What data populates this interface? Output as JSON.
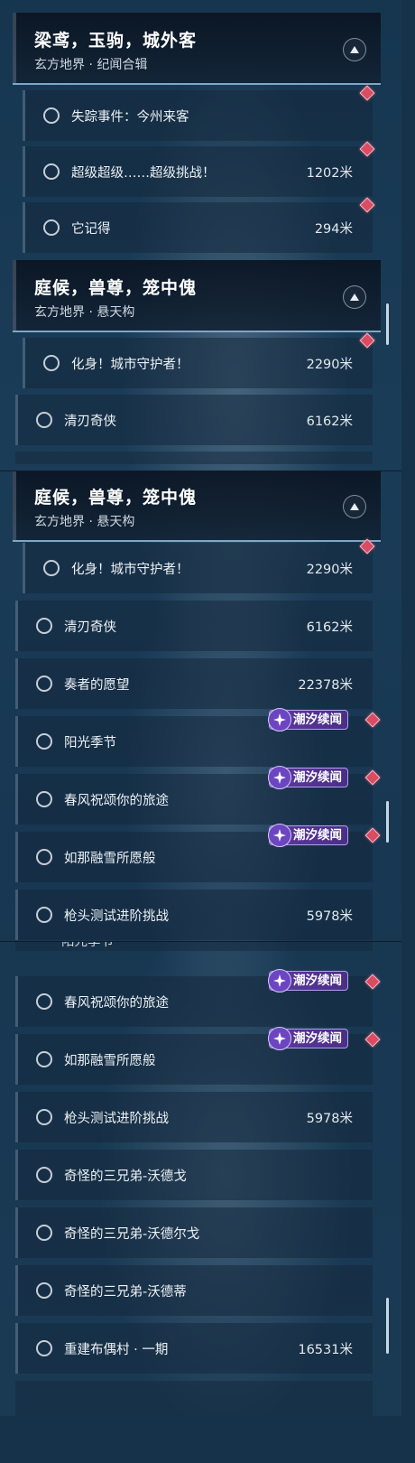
{
  "panel1": {
    "header": {
      "title": "梁鸢，玉驹，城外客",
      "subtitle": "玄方地界 · 纪闻合辑"
    },
    "items": [
      {
        "label": "失踪事件：今州来客",
        "distance": ""
      },
      {
        "label": "超级超级……超级挑战！",
        "distance": "1202米"
      },
      {
        "label": "它记得",
        "distance": "294米"
      }
    ],
    "header2": {
      "title": "庭候，兽尊，笼中傀",
      "subtitle": "玄方地界 · 悬天构"
    },
    "items2": [
      {
        "label": "化身！城市守护者！",
        "distance": "2290米"
      },
      {
        "label": "清刃奇侠",
        "distance": "6162米"
      }
    ]
  },
  "panel2": {
    "header": {
      "title": "庭候，兽尊，笼中傀",
      "subtitle": "玄方地界 · 悬天构"
    },
    "items": [
      {
        "label": "化身！城市守护者！",
        "distance": "2290米"
      },
      {
        "label": "清刃奇侠",
        "distance": "6162米"
      },
      {
        "label": "奏者的愿望",
        "distance": "22378米"
      },
      {
        "label": "阳光季节",
        "distance": ""
      },
      {
        "label": "春风祝颂你的旅途",
        "distance": ""
      },
      {
        "label": "如那融雪所愿般",
        "distance": ""
      },
      {
        "label": "枪头测试进阶挑战",
        "distance": "5978米"
      }
    ]
  },
  "panel3": {
    "partial_label": "阳光季节",
    "items": [
      {
        "label": "春风祝颂你的旅途",
        "distance": ""
      },
      {
        "label": "如那融雪所愿般",
        "distance": ""
      },
      {
        "label": "枪头测试进阶挑战",
        "distance": "5978米"
      },
      {
        "label": "奇怪的三兄弟-沃德戈",
        "distance": ""
      },
      {
        "label": "奇怪的三兄弟-沃德尔戈",
        "distance": ""
      },
      {
        "label": "奇怪的三兄弟-沃德蒂",
        "distance": ""
      },
      {
        "label": "重建布偶村 · 一期",
        "distance": "16531米"
      }
    ]
  },
  "tag_label": "潮汐续闻",
  "icons": {
    "collapse": "chevron-up-icon",
    "radio": "radio-empty-icon",
    "marker": "diamond-marker-icon",
    "tag": "tidal-star-icon"
  },
  "colors": {
    "marker": "#d94c62",
    "tag_bg": "#5b3aa0",
    "header_border": "#7ea8c6"
  }
}
